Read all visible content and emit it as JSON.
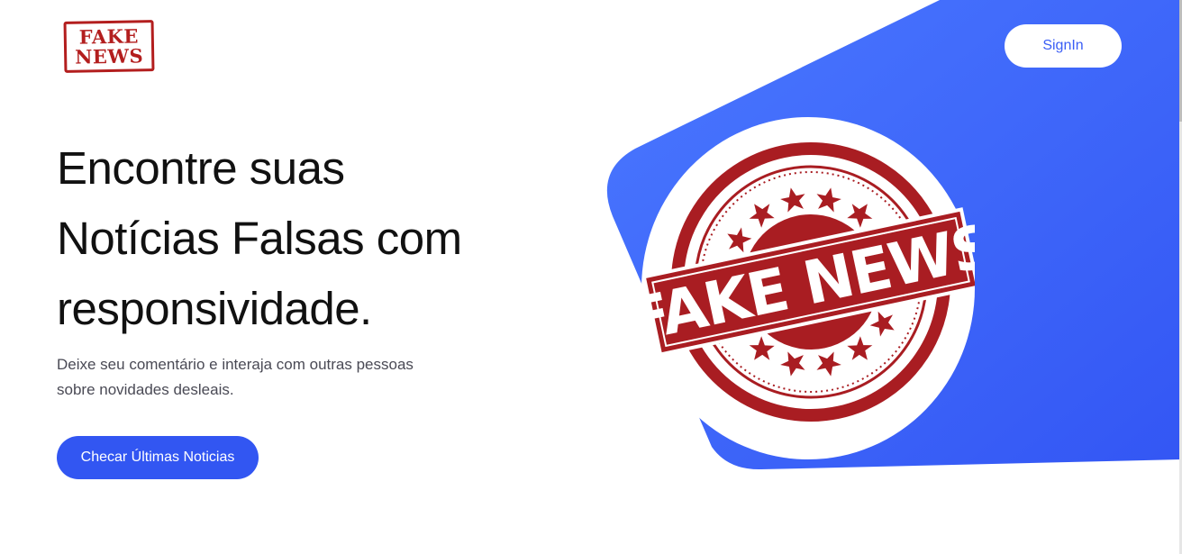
{
  "logo": {
    "line1": "FAKE",
    "line2": "NEWS"
  },
  "header": {
    "signin_label": "SignIn"
  },
  "hero": {
    "headline_lines": [
      "Encontre suas",
      "Notícias Falsas com",
      "responsividade."
    ],
    "subtitle_lines": [
      "Deixe seu comentário e interaja com outras pessoas",
      "sobre novidades desleais."
    ],
    "cta_label": "Checar Últimas Noticias",
    "stamp_text": "FAKE NEWS"
  },
  "colors": {
    "accent_blue": "#3256f2",
    "stamp_red": "#b31e1e",
    "headline": "#111111"
  }
}
